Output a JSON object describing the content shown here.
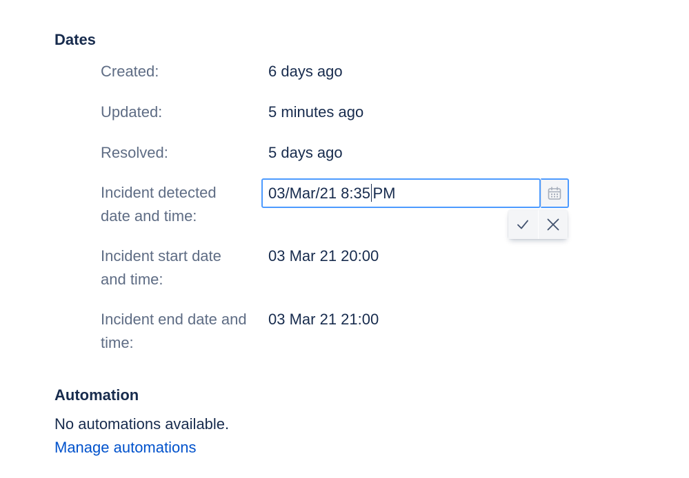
{
  "dates_section": {
    "heading": "Dates",
    "fields": [
      {
        "label": "Created:",
        "value": "6 days ago"
      },
      {
        "label": "Updated:",
        "value": "5 minutes ago"
      },
      {
        "label": "Resolved:",
        "value": "5 days ago"
      },
      {
        "label": "Incident detected date and time:",
        "editor_value_before_caret": "03/Mar/21 8:35",
        "editor_value_after_caret": "PM"
      },
      {
        "label": "Incident start date and time:",
        "value": "03 Mar 21 20:00"
      },
      {
        "label": "Incident end date and time:",
        "value": "03 Mar 21 21:00"
      }
    ]
  },
  "icons": {
    "calendar": "calendar-icon",
    "confirm": "check-icon",
    "cancel": "close-icon"
  },
  "automation_section": {
    "heading": "Automation",
    "empty_text": "No automations available.",
    "manage_link": "Manage automations"
  },
  "colors": {
    "heading": "#172b4d",
    "label": "#5e6c84",
    "focus_border": "#4c9aff",
    "link": "#0052cc"
  }
}
